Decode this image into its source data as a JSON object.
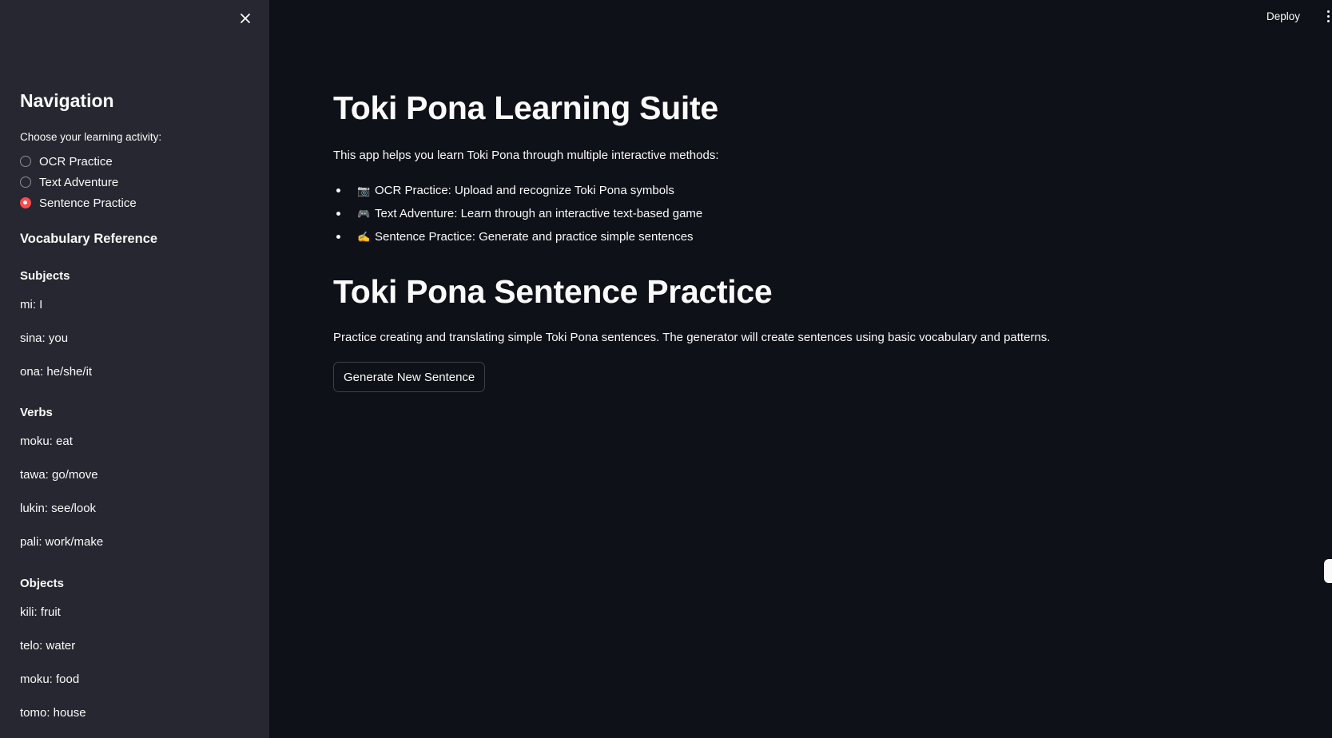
{
  "sidebar": {
    "close_icon": "close-icon",
    "title": "Navigation",
    "radio_label": "Choose your learning activity:",
    "options": [
      {
        "label": "OCR Practice",
        "selected": false
      },
      {
        "label": "Text Adventure",
        "selected": false
      },
      {
        "label": "Sentence Practice",
        "selected": true
      }
    ],
    "vocab_title": "Vocabulary Reference",
    "sections": [
      {
        "heading": "Subjects",
        "items": [
          "mi: I",
          "sina: you",
          "ona: he/she/it"
        ]
      },
      {
        "heading": "Verbs",
        "items": [
          "moku: eat",
          "tawa: go/move",
          "lukin: see/look",
          "pali: work/make"
        ]
      },
      {
        "heading": "Objects",
        "items": [
          "kili: fruit",
          "telo: water",
          "moku: food",
          "tomo: house"
        ]
      }
    ]
  },
  "header": {
    "deploy_label": "Deploy",
    "menu_icon": "kebab-menu-icon"
  },
  "main": {
    "title": "Toki Pona Learning Suite",
    "intro": "This app helps you learn Toki Pona through multiple interactive methods:",
    "features": [
      {
        "icon": "📷",
        "text": "OCR Practice: Upload and recognize Toki Pona symbols"
      },
      {
        "icon": "🎮",
        "text": "Text Adventure: Learn through an interactive text-based game"
      },
      {
        "icon": "✍️",
        "text": "Sentence Practice: Generate and practice simple sentences"
      }
    ],
    "section_title": "Toki Pona Sentence Practice",
    "description": "Practice creating and translating simple Toki Pona sentences. The generator will create sentences using basic vocabulary and patterns.",
    "button_label": "Generate New Sentence"
  },
  "colors": {
    "background": "#0e1117",
    "sidebar": "#262730",
    "accent": "#ff4b4b",
    "text": "#fafafa"
  }
}
